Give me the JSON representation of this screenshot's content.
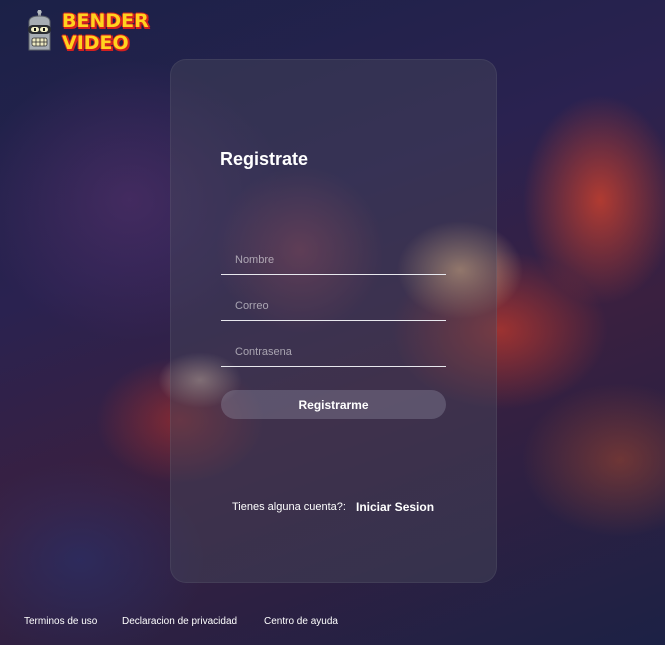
{
  "brand": {
    "line1": "BENDER",
    "line2": "VIDEO",
    "icon": "bender-robot-icon"
  },
  "form": {
    "title": "Registrate",
    "name_placeholder": "Nombre",
    "email_placeholder": "Correo",
    "password_placeholder": "Contrasena",
    "submit_label": "Registrarme",
    "account_prompt": "Tienes alguna cuenta?:",
    "signin_label": "Iniciar Sesion"
  },
  "footer": {
    "links": [
      "Terminos de uso",
      "Declaracion de privacidad",
      "Centro de ayuda"
    ]
  },
  "colors": {
    "text": "#ffffff",
    "logo_fill": "#ffd21f",
    "logo_outline": "#d42020"
  }
}
